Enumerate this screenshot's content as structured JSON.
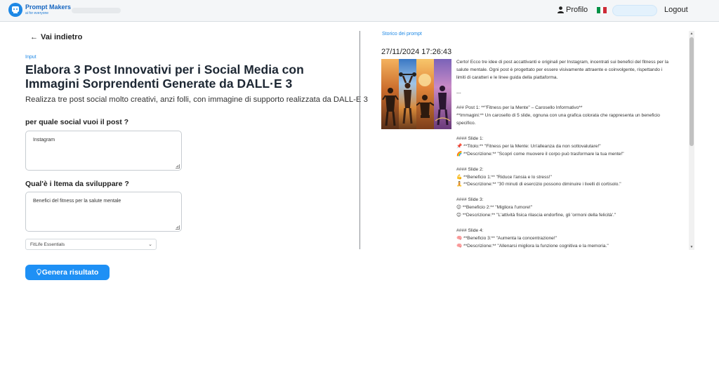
{
  "nav": {
    "brand": "Prompt Makers",
    "brand_tagline": "ai for everyone",
    "profile_label": "Profilo",
    "logout_label": "Logout",
    "flag_colors": [
      "#009246",
      "#ffffff",
      "#ce2b37"
    ]
  },
  "left": {
    "back_label": "Vai indietro",
    "input_label": "Input",
    "title": "Elabora 3 Post Innovativi per i Social Media con Immagini Sorprendenti Generate da DALL·E 3",
    "description": "Realizza tre post social molto creativi, anzi folli, con immagine di supporto realizzata da DALL-E 3",
    "question1": "per quale social vuoi il post ?",
    "answer1": "Instagram",
    "question2": "Qual'è i ltema da sviluppare ?",
    "answer2": "Benefici del fitness per la salute mentale",
    "select_value": "FitLife Essentials",
    "generate_label": "Genera risultato"
  },
  "right": {
    "history_label": "Storico dei prompt",
    "timestamp": "27/11/2024 17:26:43",
    "result_lines": [
      "Certo! Ecco tre idee di post accattivanti e originali per Instagram, incentrati sui benefici del fitness per la",
      "salute mentale. Ogni post è progettato per essere visivamente attraente e coinvolgente, rispettando i",
      "limiti di caratteri e le linee guida della piattaforma.",
      "",
      "---",
      "",
      "### Post 1: **\"Fitness per la Mente\" – Carosello Informativo**",
      "**Immagini:** Un carosello di 5 slide, ognuna con una grafica colorata che rappresenta un beneficio",
      "specifico.",
      "",
      "#### Slide 1:",
      "📌 **Titolo:** \"Fitness per la Mente: Un'alleanza da non sottovalutare!\"",
      "🌈 **Descrizione:** \"Scopri come muovere il corpo può trasformare la tua mente!\"",
      "",
      "#### Slide 2:",
      "💪 **Beneficio 1:** \"Riduce l'ansia e lo stress!\"",
      "🧘 **Descrizione:** \"30 minuti di esercizio possono diminuire i livelli di cortisolo.\"",
      "",
      "#### Slide 3:",
      "😊 **Beneficio 2:** \"Migliora l'umore!\"",
      "😊 **Descrizione:** \"L'attività fisica rilascia endorfine, gli 'ormoni della felicità'.\"",
      "",
      "#### Slide 4:",
      "🧠 **Beneficio 3:** \"Aumenta la concentrazione!\"",
      "🧠 **Descrizione:** \"Allenarsi migliora la funzione cognitiva e la memoria.\""
    ]
  }
}
